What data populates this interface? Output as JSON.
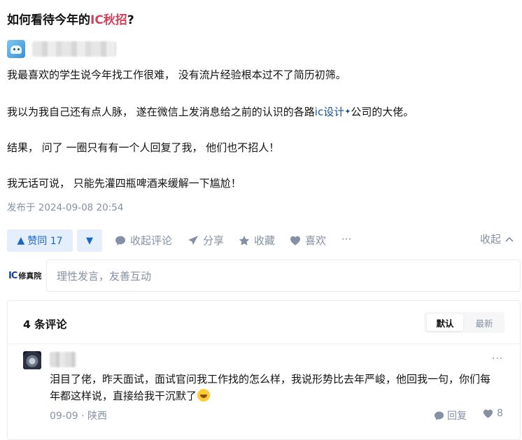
{
  "question": {
    "title_prefix": "如何看待今年的",
    "title_highlight": "IC秋招",
    "title_suffix": "?"
  },
  "answer": {
    "paragraphs": {
      "p1": "我最喜欢的学生说今年找工作很难， 没有流片经验根本过不了简历初筛。",
      "p2_before": "我以为我自己还有点人脉， 遂在微信上发消息给之前的认识的各路",
      "p2_link": "ic设计",
      "p2_after": "公司的大佬。",
      "p3": "结果， 问了 一圈只有有一个人回复了我， 他们也不招人！",
      "p4": "我无话可说， 只能先灌四瓶啤酒来缓解一下尴尬！"
    },
    "published": "发布于 2024-09-08 20:54"
  },
  "actions": {
    "upvote_label": "赞同 17",
    "collapse_comments": "收起评论",
    "share": "分享",
    "favorite": "收藏",
    "like": "喜欢",
    "more": "···",
    "collapse": "收起"
  },
  "comment_box": {
    "brand_mark": "IC",
    "brand_name": "修真院",
    "placeholder": "理性发言，友善互动"
  },
  "comments": {
    "count_label": "4 条评论",
    "sort_default": "默认",
    "sort_latest": "最新",
    "items": [
      {
        "text": "泪目了佬，昨天面试，面试官问我工作找的怎么样，我说形势比去年严峻，他回我一句，你们每年都这样说，直接给我干沉默了",
        "meta": "09-09 · 陕西",
        "reply": "回复",
        "likes": "8",
        "more": "···"
      }
    ]
  },
  "colors": {
    "accent": "#1966c8",
    "highlight": "#d0435a",
    "muted": "#8590a6",
    "vote_bg": "#e5effb"
  }
}
